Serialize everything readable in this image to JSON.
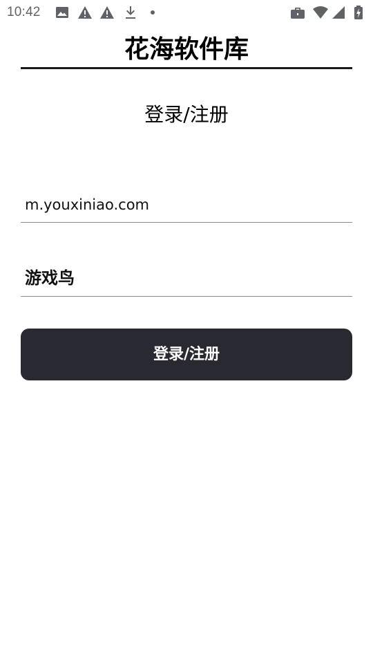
{
  "status_bar": {
    "time": "10:42",
    "left_icons": [
      "image-icon",
      "warning-icon",
      "warning-icon",
      "download-icon",
      "dot-icon"
    ],
    "right_icons": [
      "briefcase-icon",
      "wifi-icon",
      "signal-icon",
      "battery-charging-icon"
    ],
    "icon_color": "#5f6368"
  },
  "header": {
    "title": "花海软件库"
  },
  "form": {
    "heading": "登录/注册",
    "url_field": {
      "value": "m.youxiniao.com"
    },
    "name_field": {
      "value": "游戏鸟"
    },
    "submit_label": "登录/注册"
  },
  "colors": {
    "button_bg": "#292932",
    "button_text": "#ffffff",
    "divider": "#1a1a1a",
    "field_underline": "#8a8a8a"
  }
}
